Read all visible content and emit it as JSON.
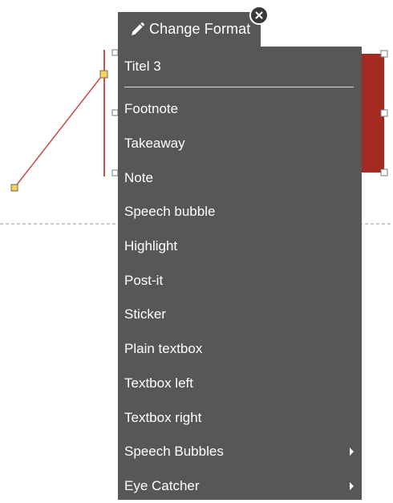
{
  "format_tab": {
    "label": "Change Format",
    "icon": "pencil-icon",
    "close_icon": "close-icon"
  },
  "menu": {
    "header": "Titel 3",
    "items": [
      {
        "label": "Footnote",
        "submenu": false
      },
      {
        "label": "Takeaway",
        "submenu": false
      },
      {
        "label": "Note",
        "submenu": false
      },
      {
        "label": "Speech bubble",
        "submenu": false
      },
      {
        "label": "Highlight",
        "submenu": false
      },
      {
        "label": "Post-it",
        "submenu": false
      },
      {
        "label": "Sticker",
        "submenu": false
      },
      {
        "label": "Plain textbox",
        "submenu": false
      },
      {
        "label": "Textbox left",
        "submenu": false
      },
      {
        "label": "Textbox right",
        "submenu": false
      },
      {
        "label": "Speech Bubbles",
        "submenu": true
      },
      {
        "label": "Eye Catcher",
        "submenu": true
      }
    ]
  },
  "colors": {
    "menu_bg": "#575757",
    "accent_red": "#a52a1f",
    "connector_line": "#c8524d",
    "handle_yellow": "#f5d454"
  }
}
